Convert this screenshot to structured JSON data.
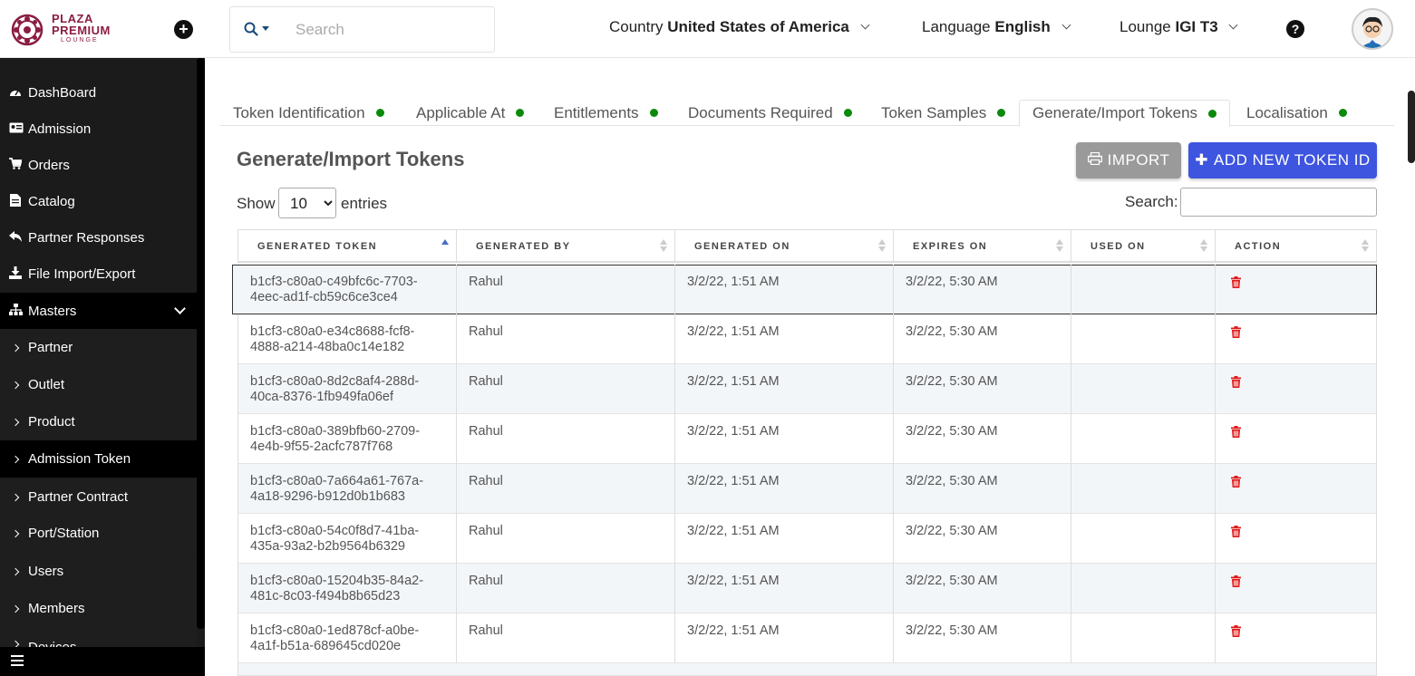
{
  "header": {
    "logo": {
      "line1": "PLAZA",
      "line2": "PREMIUM",
      "line3": "LOUNGE",
      "color": "#8b1d41"
    },
    "search_placeholder": "Search",
    "country": {
      "label": "Country",
      "value": "United States of America"
    },
    "language": {
      "label": "Language",
      "value": "English"
    },
    "lounge": {
      "label": "Lounge",
      "value": "IGI T3"
    },
    "help_icon": "question-circle-icon",
    "add_icon": "plus-circle-icon"
  },
  "sidebar": {
    "items": [
      {
        "label": "DashBoard",
        "icon": "tachometer-icon"
      },
      {
        "label": "Admission",
        "icon": "id-card-icon"
      },
      {
        "label": "Orders",
        "icon": "cart-icon"
      },
      {
        "label": "Catalog",
        "icon": "file-icon"
      },
      {
        "label": "Partner Responses",
        "icon": "reply-icon"
      },
      {
        "label": "File Import/Export",
        "icon": "download-icon"
      },
      {
        "label": "Masters",
        "icon": "sitemap-icon"
      }
    ],
    "sub_items": [
      {
        "label": "Partner"
      },
      {
        "label": "Outlet"
      },
      {
        "label": "Product"
      },
      {
        "label": "Admission Token",
        "active": true
      },
      {
        "label": "Partner Contract"
      },
      {
        "label": "Port/Station"
      },
      {
        "label": "Users"
      },
      {
        "label": "Members"
      },
      {
        "label": "Devices"
      }
    ]
  },
  "tabs": [
    {
      "label": "Token Identification"
    },
    {
      "label": "Applicable At"
    },
    {
      "label": "Entitlements"
    },
    {
      "label": "Documents Required"
    },
    {
      "label": "Token Samples"
    },
    {
      "label": "Generate/Import Tokens",
      "active": true
    },
    {
      "label": "Localisation"
    }
  ],
  "page": {
    "title": "Generate/Import Tokens",
    "import_label": "IMPORT",
    "add_label": "ADD NEW TOKEN ID",
    "show_label": "Show",
    "entries_value": "10",
    "entries_label": "entries",
    "search_label": "Search:"
  },
  "colors": {
    "add_button": "#3e55e0",
    "import_button": "#9a9a9a",
    "status_dot": "#0a8a0a",
    "delete_icon": "#e01a1a"
  },
  "table": {
    "columns": [
      "GENERATED TOKEN",
      "GENERATED BY",
      "GENERATED ON",
      "EXPIRES ON",
      "USED ON",
      "ACTION"
    ],
    "rows": [
      {
        "token_1": "b1cf3-c80a0-c49bfc6c-7703-",
        "token_2": "4eec-ad1f-cb59c6ce3ce4",
        "by": "Rahul",
        "on": "3/2/22, 1:51 AM",
        "expires": "3/2/22, 5:30 AM",
        "used": ""
      },
      {
        "token_1": "b1cf3-c80a0-e34c8688-fcf8-",
        "token_2": "4888-a214-48ba0c14e182",
        "by": "Rahul",
        "on": "3/2/22, 1:51 AM",
        "expires": "3/2/22, 5:30 AM",
        "used": ""
      },
      {
        "token_1": "b1cf3-c80a0-8d2c8af4-288d-",
        "token_2": "40ca-8376-1fb949fa06ef",
        "by": "Rahul",
        "on": "3/2/22, 1:51 AM",
        "expires": "3/2/22, 5:30 AM",
        "used": ""
      },
      {
        "token_1": "b1cf3-c80a0-389bfb60-2709-",
        "token_2": "4e4b-9f55-2acfc787f768",
        "by": "Rahul",
        "on": "3/2/22, 1:51 AM",
        "expires": "3/2/22, 5:30 AM",
        "used": ""
      },
      {
        "token_1": "b1cf3-c80a0-7a664a61-767a-",
        "token_2": "4a18-9296-b912d0b1b683",
        "by": "Rahul",
        "on": "3/2/22, 1:51 AM",
        "expires": "3/2/22, 5:30 AM",
        "used": ""
      },
      {
        "token_1": "b1cf3-c80a0-54c0f8d7-41ba-",
        "token_2": "435a-93a2-b2b9564b6329",
        "by": "Rahul",
        "on": "3/2/22, 1:51 AM",
        "expires": "3/2/22, 5:30 AM",
        "used": ""
      },
      {
        "token_1": "b1cf3-c80a0-15204b35-84a2-",
        "token_2": "481c-8c03-f494b8b65d23",
        "by": "Rahul",
        "on": "3/2/22, 1:51 AM",
        "expires": "3/2/22, 5:30 AM",
        "used": ""
      },
      {
        "token_1": "b1cf3-c80a0-1ed878cf-a0be-",
        "token_2": "4a1f-b51a-689645cd020e",
        "by": "Rahul",
        "on": "3/2/22, 1:51 AM",
        "expires": "3/2/22, 5:30 AM",
        "used": ""
      }
    ]
  }
}
